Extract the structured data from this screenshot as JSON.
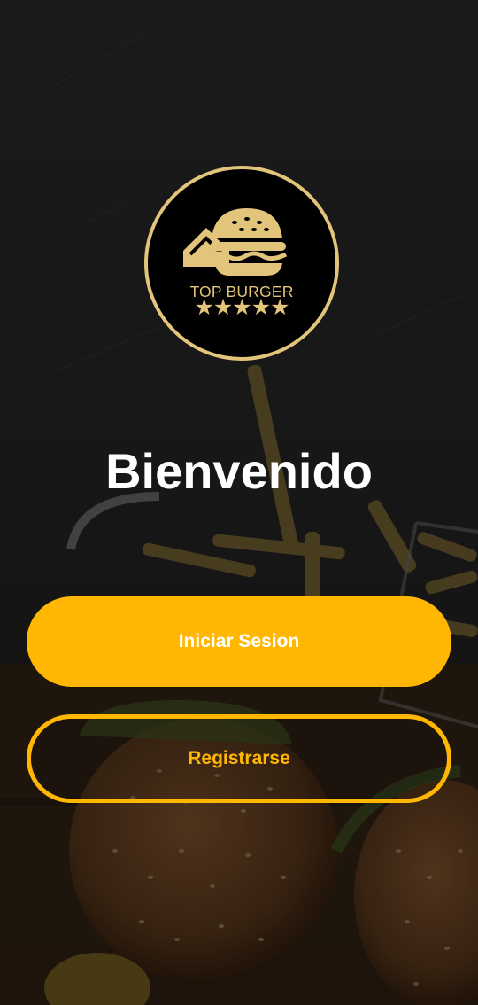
{
  "logo": {
    "brand": "TOP BURGER",
    "stars": "★★★★★"
  },
  "welcome": {
    "title": "Bienvenido"
  },
  "actions": {
    "login_label": "Iniciar Sesion",
    "register_label": "Registrarse"
  },
  "colors": {
    "accent": "#ffb703",
    "logo_gold": "#e2c47a",
    "background": "#1b1b1b"
  }
}
